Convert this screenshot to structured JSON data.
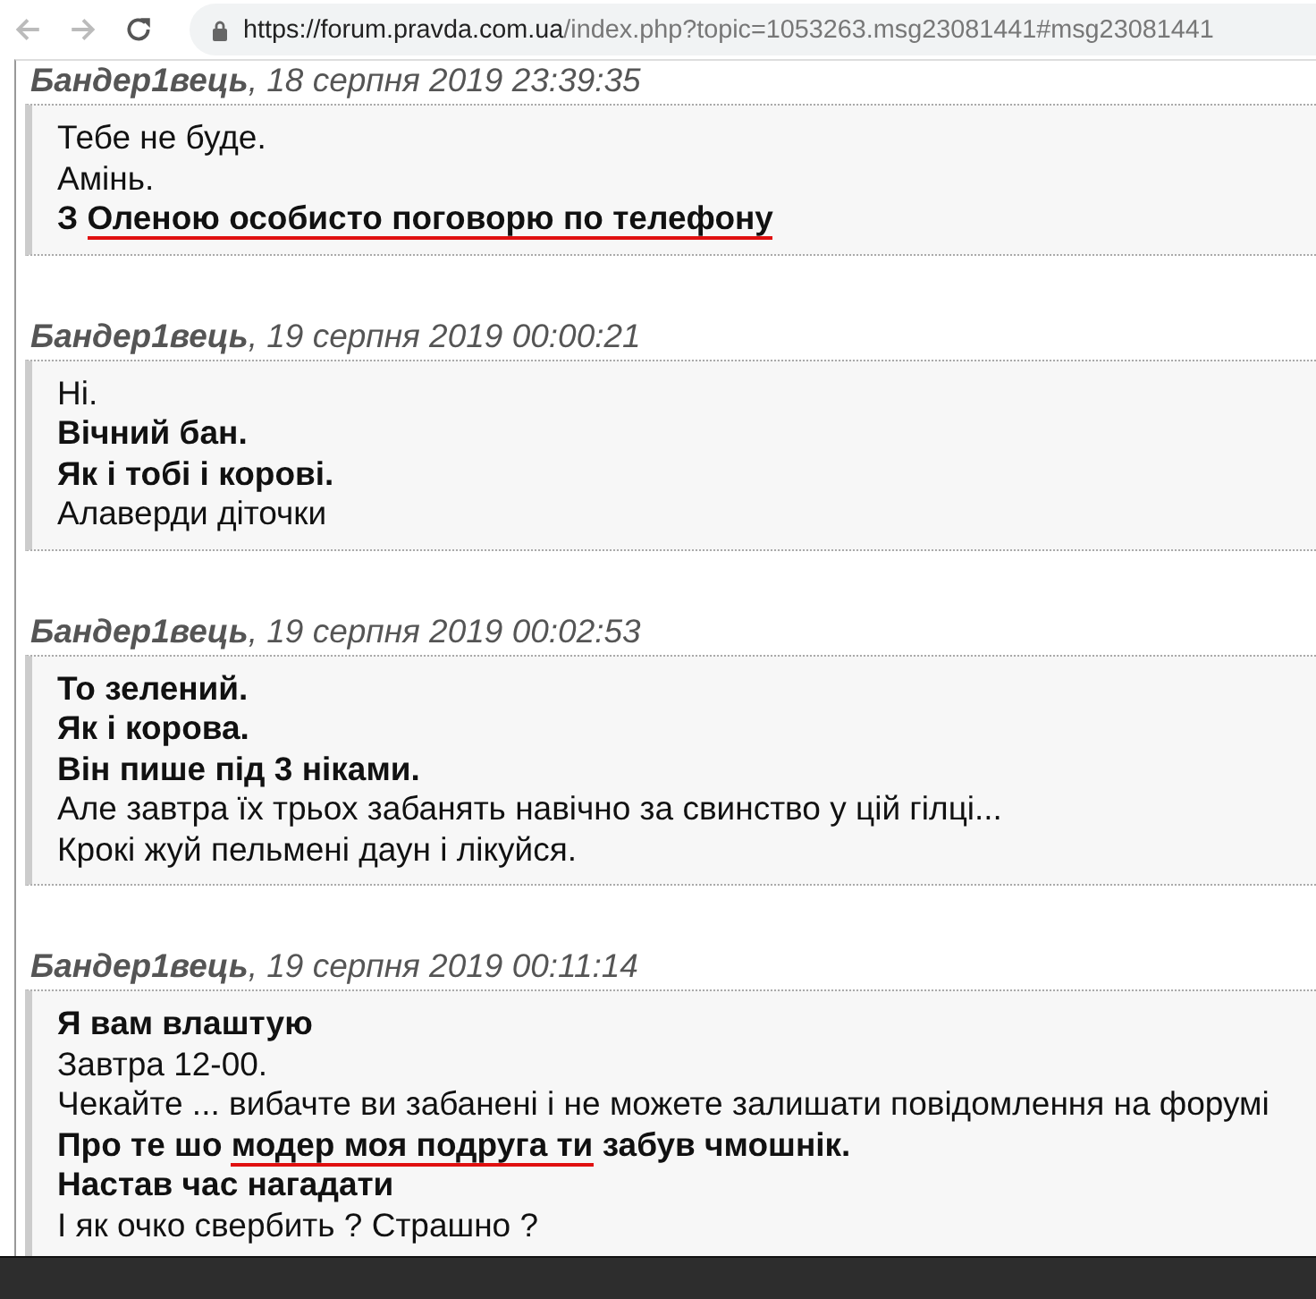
{
  "browser": {
    "url_host": "https://forum.pravda.com.ua",
    "url_path": "/index.php?topic=1053263.msg23081441#msg23081441"
  },
  "posts": [
    {
      "author": "Бандер1вець",
      "date": ", 18 серпня 2019 23:39:35",
      "lines": [
        {
          "bold": false,
          "parts": [
            {
              "text": "Тебе не буде.",
              "underlined": false
            }
          ]
        },
        {
          "bold": false,
          "parts": [
            {
              "text": "Амінь.",
              "underlined": false
            }
          ]
        },
        {
          "bold": true,
          "parts": [
            {
              "text": "З ",
              "underlined": false
            },
            {
              "text": "Оленою особисто поговорю по телефону",
              "underlined": true
            }
          ]
        }
      ]
    },
    {
      "author": "Бандер1вець",
      "date": ", 19 серпня 2019 00:00:21",
      "lines": [
        {
          "bold": false,
          "parts": [
            {
              "text": "Ні.",
              "underlined": false
            }
          ]
        },
        {
          "bold": true,
          "parts": [
            {
              "text": "Вічний бан.",
              "underlined": false
            }
          ]
        },
        {
          "bold": true,
          "parts": [
            {
              "text": "Як і тобі і корові.",
              "underlined": false
            }
          ]
        },
        {
          "bold": false,
          "parts": [
            {
              "text": "Алаверди діточки",
              "underlined": false
            }
          ]
        }
      ]
    },
    {
      "author": "Бандер1вець",
      "date": ", 19 серпня 2019 00:02:53",
      "lines": [
        {
          "bold": true,
          "parts": [
            {
              "text": "То зелений.",
              "underlined": false
            }
          ]
        },
        {
          "bold": true,
          "parts": [
            {
              "text": "Як і корова.",
              "underlined": false
            }
          ]
        },
        {
          "bold": true,
          "parts": [
            {
              "text": "Він пише під 3 ніками.",
              "underlined": false
            }
          ]
        },
        {
          "bold": false,
          "parts": [
            {
              "text": "Але завтра їх трьох забанять навічно за свинство у цій гілці...",
              "underlined": false
            }
          ]
        },
        {
          "bold": false,
          "parts": [
            {
              "text": "Крокі жуй пельмені даун і лікуйся.",
              "underlined": false
            }
          ]
        }
      ]
    },
    {
      "author": "Бандер1вець",
      "date": ", 19 серпня 2019 00:11:14",
      "lines": [
        {
          "bold": true,
          "parts": [
            {
              "text": "Я вам влаштую",
              "underlined": false
            }
          ]
        },
        {
          "bold": false,
          "parts": [
            {
              "text": "Завтра 12-00.",
              "underlined": false
            }
          ]
        },
        {
          "bold": false,
          "parts": [
            {
              "text": "Чекайте ... вибачте ви забанені і не можете залишати повідомлення на форумі",
              "underlined": false
            }
          ]
        },
        {
          "bold": true,
          "parts": [
            {
              "text": "Про те шо ",
              "underlined": false
            },
            {
              "text": "модер моя подруга ти",
              "underlined": true
            },
            {
              "text": " забув чмошнік.",
              "underlined": false
            }
          ]
        },
        {
          "bold": true,
          "parts": [
            {
              "text": "Настав час нагадати",
              "underlined": false
            }
          ]
        },
        {
          "bold": false,
          "parts": [
            {
              "text": "І як очко свербить ? Страшно ?",
              "underlined": false
            }
          ]
        }
      ]
    }
  ]
}
